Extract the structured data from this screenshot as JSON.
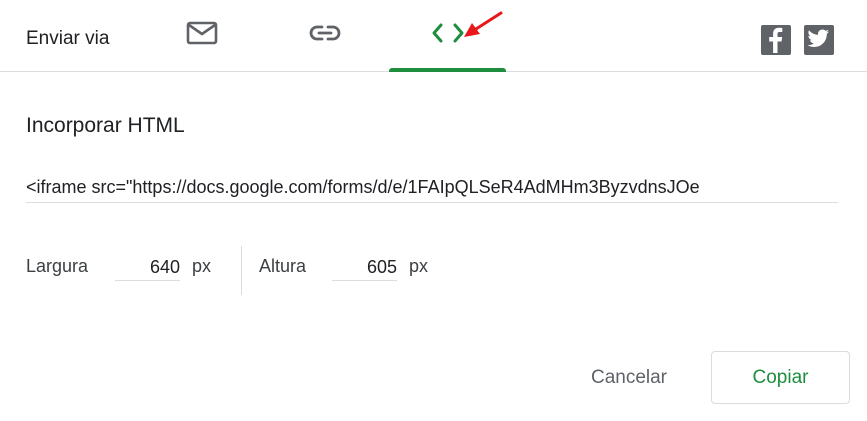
{
  "header": {
    "send_via_label": "Enviar via",
    "tabs": [
      {
        "name": "email",
        "icon": "mail-icon",
        "active": false
      },
      {
        "name": "link",
        "icon": "link-icon",
        "active": false
      },
      {
        "name": "embed",
        "icon": "code-icon",
        "active": true
      }
    ],
    "social": [
      {
        "icon": "facebook-icon"
      },
      {
        "icon": "twitter-icon"
      }
    ]
  },
  "embed": {
    "title": "Incorporar HTML",
    "code": "<iframe src=\"https://docs.google.com/forms/d/e/1FAIpQLSeR4AdMHm3ByzvdnsJOe",
    "width_label": "Largura",
    "width_value": "640",
    "width_unit": "px",
    "height_label": "Altura",
    "height_value": "605",
    "height_unit": "px"
  },
  "actions": {
    "cancel_label": "Cancelar",
    "copy_label": "Copiar"
  },
  "colors": {
    "accent": "#1e8e3e",
    "icon_gray": "#5f6368",
    "annotation_red": "#e8171b"
  }
}
